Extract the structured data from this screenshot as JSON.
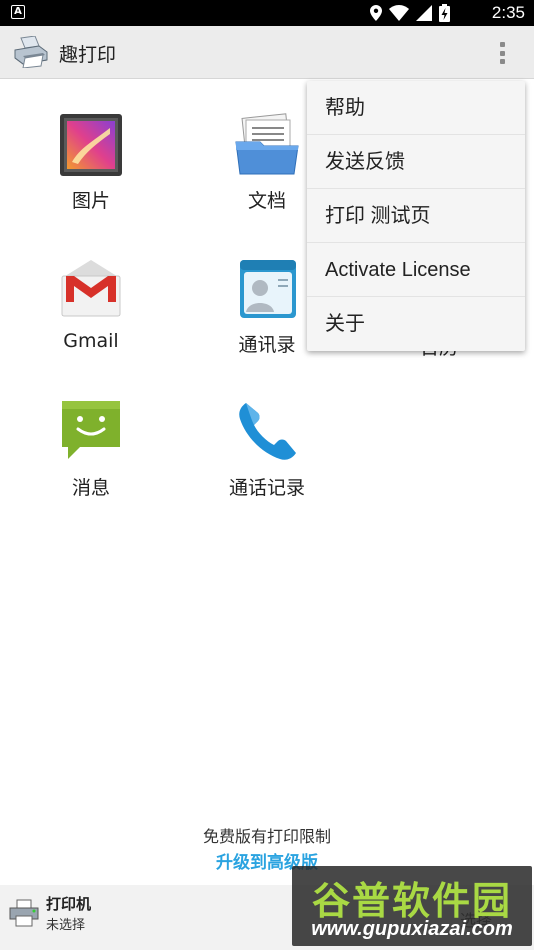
{
  "status_bar": {
    "left_icon": "A",
    "icons": [
      "location-icon",
      "wifi-icon",
      "signal-icon",
      "battery-charging-icon"
    ],
    "time": "2:35"
  },
  "app_bar": {
    "title": "趣打印",
    "logo_icon": "printer-app-logo",
    "overflow_icon": "more-vert-icon"
  },
  "grid": [
    {
      "label": "图片",
      "icon": "gallery-icon"
    },
    {
      "label": "文档",
      "icon": "folder-documents-icon"
    },
    {
      "label": "Gmail",
      "icon": "gmail-icon"
    },
    {
      "label": "通讯录",
      "icon": "contacts-icon"
    },
    {
      "label": "消息",
      "icon": "messages-icon"
    },
    {
      "label": "通话记录",
      "icon": "phone-icon"
    }
  ],
  "hidden_partial_label": "日历",
  "menu": {
    "items": [
      {
        "label": "帮助"
      },
      {
        "label": "发送反馈"
      },
      {
        "label": "打印 测试页"
      },
      {
        "label": "Activate License"
      },
      {
        "label": "关于"
      }
    ]
  },
  "footer": {
    "limit_text": "免费版有打印限制",
    "upgrade_text": "升级到高级版"
  },
  "printer_bar": {
    "title": "打印机",
    "subtitle": "未选择",
    "select_label": "选择"
  },
  "watermark": {
    "title": "谷普软件园",
    "url": "www.gupuxiazai.com"
  },
  "colors": {
    "accent": "#2aa3e0",
    "app_bar": "#ececec",
    "status_bar": "#000000",
    "watermark_green": "#a9d944"
  }
}
